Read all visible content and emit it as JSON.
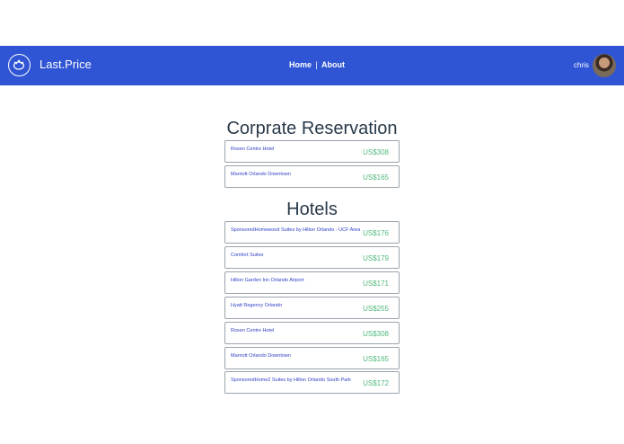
{
  "header": {
    "brand": "Last.Price",
    "nav": {
      "home": "Home",
      "separator": "|",
      "about": "About"
    },
    "user": "chris",
    "logo_icon": "piggy-bank-icon",
    "accent_color": "#2f55d4"
  },
  "corporate": {
    "title": "Corprate Reservation",
    "items": [
      {
        "name": "Rosen Centre Hotel",
        "price": "US$308"
      },
      {
        "name": "Marriott Orlando Downtown",
        "price": "US$165"
      }
    ]
  },
  "hotels": {
    "title": "Hotels",
    "items": [
      {
        "name": "SponsoredHomewood Suites by Hilton Orlando - UCF Area",
        "price": "US$176"
      },
      {
        "name": "Comfort Suites",
        "price": "US$179"
      },
      {
        "name": "Hilton Garden Inn Orlando Airport",
        "price": "US$171"
      },
      {
        "name": "Hyatt Regency Orlando",
        "price": "US$255"
      },
      {
        "name": "Rosen Centre Hotel",
        "price": "US$308"
      },
      {
        "name": "Marriott Orlando Downtown",
        "price": "US$165"
      },
      {
        "name": "SponsoredHome2 Suites by Hilton Orlando South Park",
        "price": "US$172"
      }
    ]
  }
}
